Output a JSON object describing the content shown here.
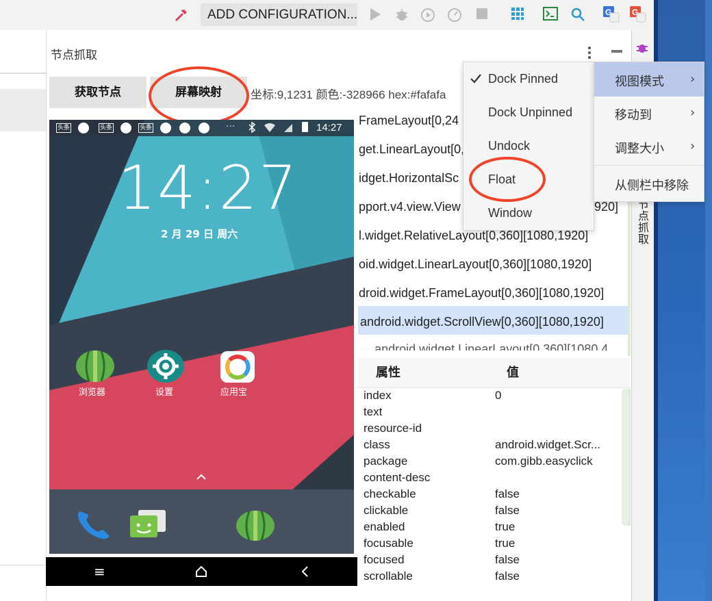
{
  "toolbar": {
    "run_config": "ADD CONFIGURATION...",
    "icons": [
      "hammer-icon",
      "play-icon",
      "debug-icon",
      "run-coverage-icon",
      "profile-icon",
      "stop-icon",
      "grid-icon",
      "terminal-icon",
      "search-icon",
      "translate-icon",
      "translate-alt-icon"
    ]
  },
  "tool_window": {
    "title": "节点抓取",
    "side_tab": "节点抓取",
    "btn_get_nodes": "获取节点",
    "btn_screen_map": "屏幕映射",
    "coord_info": "坐标:9,1231 颜色:-328966 hex:#fafafa"
  },
  "phone": {
    "status_time": "14:27",
    "clock": "14:27",
    "date": "2 月 29 日 周六",
    "apps": [
      {
        "label": "浏览器"
      },
      {
        "label": "设置"
      },
      {
        "label": "应用宝"
      }
    ],
    "status_badges": [
      "头条",
      "头条",
      "头条"
    ]
  },
  "tree": {
    "items": [
      "FrameLayout[0,24",
      "get.LinearLayout[0,",
      "idget.HorizontalSc",
      "pport.v4.view.View",
      "l.widget.RelativeLayout[0,360][1080,1920]",
      "oid.widget.LinearLayout[0,360][1080,1920]",
      "droid.widget.FrameLayout[0,360][1080,1920]",
      "android.widget.ScrollView[0,360][1080,1920]",
      "android.widget.LinearLayout[0,360][1080,4"
    ],
    "partial_suffix_row4": "1920]"
  },
  "props": {
    "col_attr": "属性",
    "col_value": "值",
    "rows": [
      {
        "k": "index",
        "v": "0"
      },
      {
        "k": "text",
        "v": ""
      },
      {
        "k": "resource-id",
        "v": ""
      },
      {
        "k": "class",
        "v": "android.widget.Scr..."
      },
      {
        "k": "package",
        "v": "com.gibb.easyclick"
      },
      {
        "k": "content-desc",
        "v": ""
      },
      {
        "k": "checkable",
        "v": "false"
      },
      {
        "k": "clickable",
        "v": "false"
      },
      {
        "k": "enabled",
        "v": "true"
      },
      {
        "k": "focusable",
        "v": "true"
      },
      {
        "k": "focused",
        "v": "false"
      },
      {
        "k": "scrollable",
        "v": "false"
      }
    ]
  },
  "menu_viewmode": {
    "items": [
      "Dock Pinned",
      "Dock Unpinned",
      "Undock",
      "Float",
      "Window"
    ],
    "checked": "Dock Pinned"
  },
  "menu_options": {
    "items": [
      {
        "label": "视图模式",
        "submenu": true
      },
      {
        "label": "移动到",
        "submenu": true
      },
      {
        "label": "调整大小",
        "submenu": true
      },
      {
        "label": "从侧栏中移除",
        "submenu": false
      }
    ]
  },
  "colors": {
    "accent_ring": "#f0442a",
    "selection": "#d3e3fa",
    "menu_highlight": "#b9c8eb"
  }
}
